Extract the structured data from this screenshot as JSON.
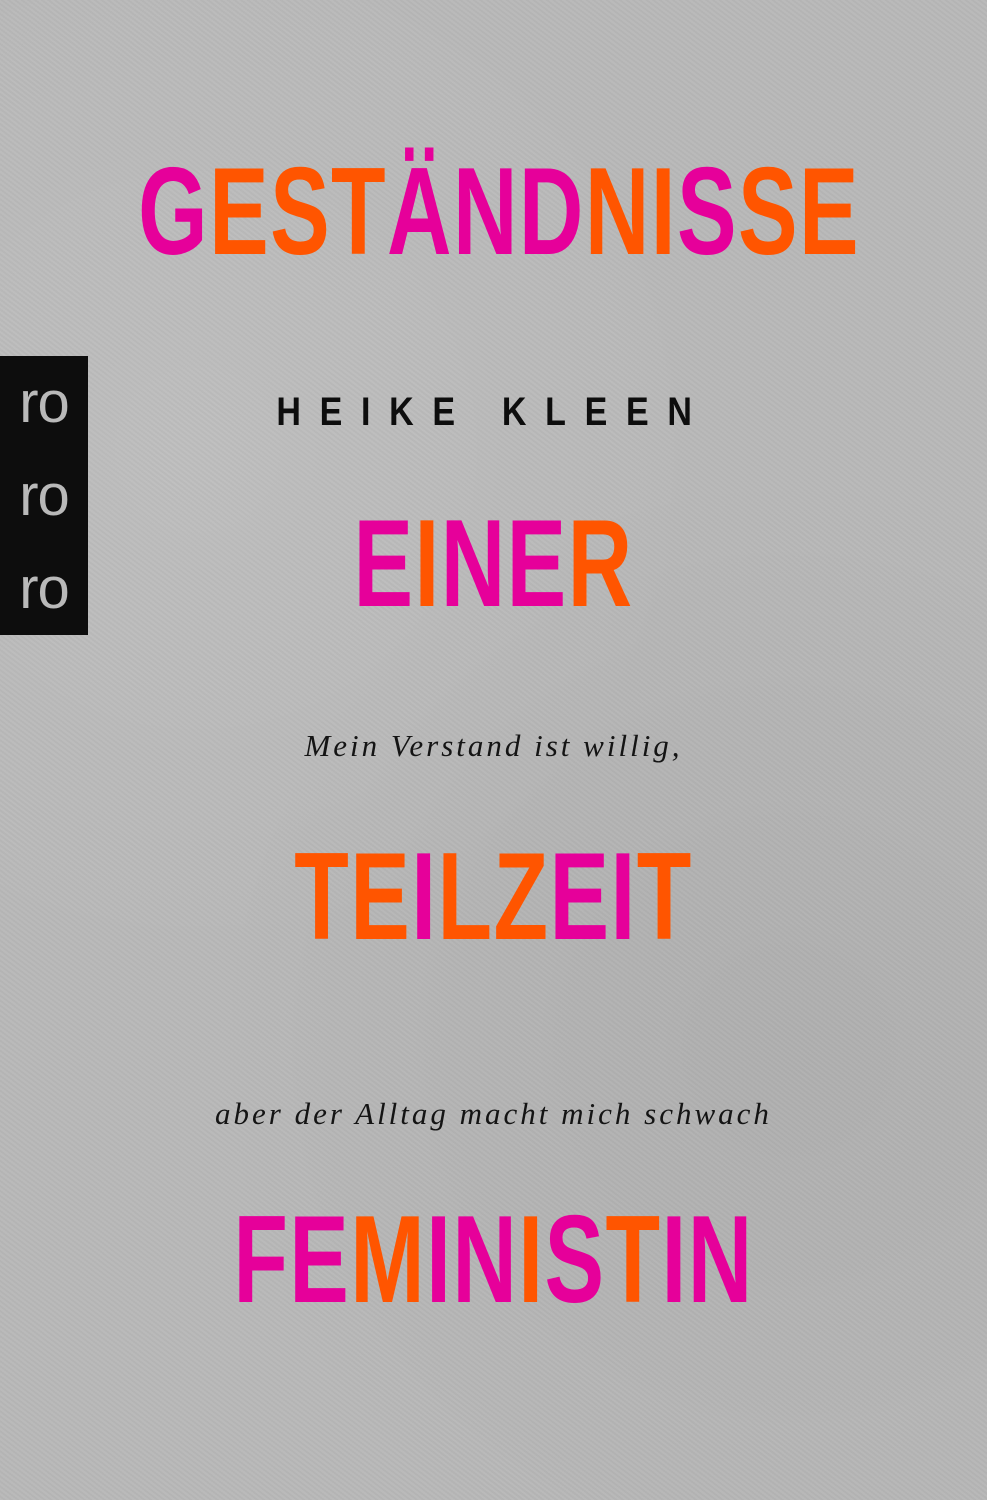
{
  "colors": {
    "pink": "#e6009a",
    "orange": "#ff5500",
    "background": "#b9b9b9",
    "text": "#111111"
  },
  "title_lines": [
    [
      {
        "text": "G",
        "color": "pink"
      },
      {
        "text": "E",
        "color": "orange"
      },
      {
        "text": "S",
        "color": "orange"
      },
      {
        "text": "T",
        "color": "orange"
      },
      {
        "text": "Ä",
        "color": "pink"
      },
      {
        "text": "N",
        "color": "pink"
      },
      {
        "text": "D",
        "color": "pink"
      },
      {
        "text": "N",
        "color": "orange"
      },
      {
        "text": "I",
        "color": "orange"
      },
      {
        "text": "S",
        "color": "pink"
      },
      {
        "text": "S",
        "color": "orange"
      },
      {
        "text": "E",
        "color": "orange"
      }
    ],
    [
      {
        "text": "E",
        "color": "pink"
      },
      {
        "text": "I",
        "color": "orange"
      },
      {
        "text": "N",
        "color": "pink"
      },
      {
        "text": "E",
        "color": "pink"
      },
      {
        "text": "R",
        "color": "orange"
      }
    ],
    [
      {
        "text": "T",
        "color": "orange"
      },
      {
        "text": "E",
        "color": "orange"
      },
      {
        "text": "I",
        "color": "pink"
      },
      {
        "text": "L",
        "color": "orange"
      },
      {
        "text": "Z",
        "color": "orange"
      },
      {
        "text": "E",
        "color": "pink"
      },
      {
        "text": "I",
        "color": "pink"
      },
      {
        "text": "T",
        "color": "orange"
      }
    ],
    [
      {
        "text": "F",
        "color": "pink"
      },
      {
        "text": "E",
        "color": "pink"
      },
      {
        "text": "M",
        "color": "orange"
      },
      {
        "text": "I",
        "color": "pink"
      },
      {
        "text": "N",
        "color": "pink"
      },
      {
        "text": "I",
        "color": "orange"
      },
      {
        "text": "S",
        "color": "pink"
      },
      {
        "text": "T",
        "color": "orange"
      },
      {
        "text": "I",
        "color": "pink"
      },
      {
        "text": "N",
        "color": "pink"
      }
    ]
  ],
  "author": "HEIKE KLEEN",
  "subtitle_line1": "Mein Verstand ist willig,",
  "subtitle_line2": "aber der Alltag macht mich schwach",
  "publisher_logo": [
    "ro",
    "ro",
    "ro"
  ]
}
